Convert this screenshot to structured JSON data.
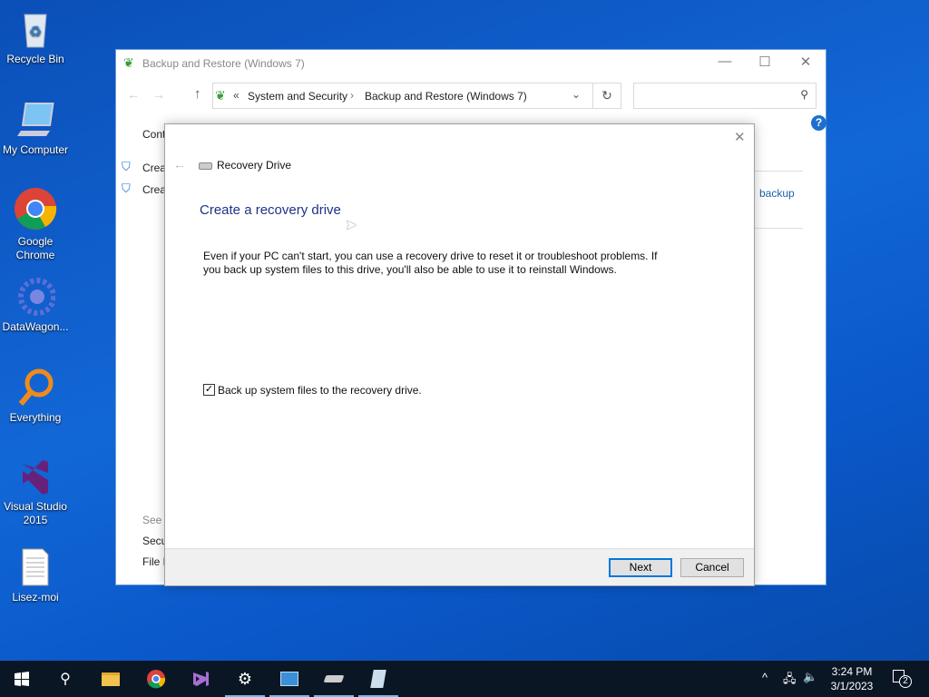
{
  "desktop": {
    "icons": [
      {
        "label": "Recycle Bin",
        "icon": "recycle-bin-icon"
      },
      {
        "label": "My Computer",
        "icon": "computer-icon"
      },
      {
        "label": "Google Chrome",
        "icon": "chrome-icon"
      },
      {
        "label": "DataWagon...",
        "icon": "datawagon-icon"
      },
      {
        "label": "Everything",
        "icon": "everything-icon"
      },
      {
        "label": "Visual Studio 2015",
        "icon": "visual-studio-icon"
      },
      {
        "label": "Lisez-moi",
        "icon": "text-file-icon"
      }
    ]
  },
  "window": {
    "title": "Backup and Restore (Windows 7)",
    "breadcrumb": [
      "System and Security",
      "Backup and Restore (Windows 7)"
    ],
    "breadcrumb_prefix": "«",
    "search_placeholder": "",
    "side": {
      "heading": "Cont",
      "links": [
        "Creat",
        "Creat"
      ],
      "see_also": "See a",
      "bottom_links": [
        "Secu",
        "File H"
      ],
      "right_link": "backup"
    }
  },
  "dialog": {
    "title": "Recovery Drive",
    "heading": "Create a recovery drive",
    "body": "Even if your PC can't start, you can use a recovery drive to reset it or troubleshoot problems. If you back up system files to this drive, you'll also be able to use it to reinstall Windows.",
    "checkbox_label": "Back up system files to the recovery drive.",
    "checkbox_checked": true,
    "next": "Next",
    "cancel": "Cancel"
  },
  "taskbar": {
    "time": "3:24 PM",
    "date": "3/1/2023",
    "notifications": "2"
  },
  "colors": {
    "accent": "#0078d7",
    "heading": "#1e3287",
    "desktop": "#0a5fc4"
  }
}
